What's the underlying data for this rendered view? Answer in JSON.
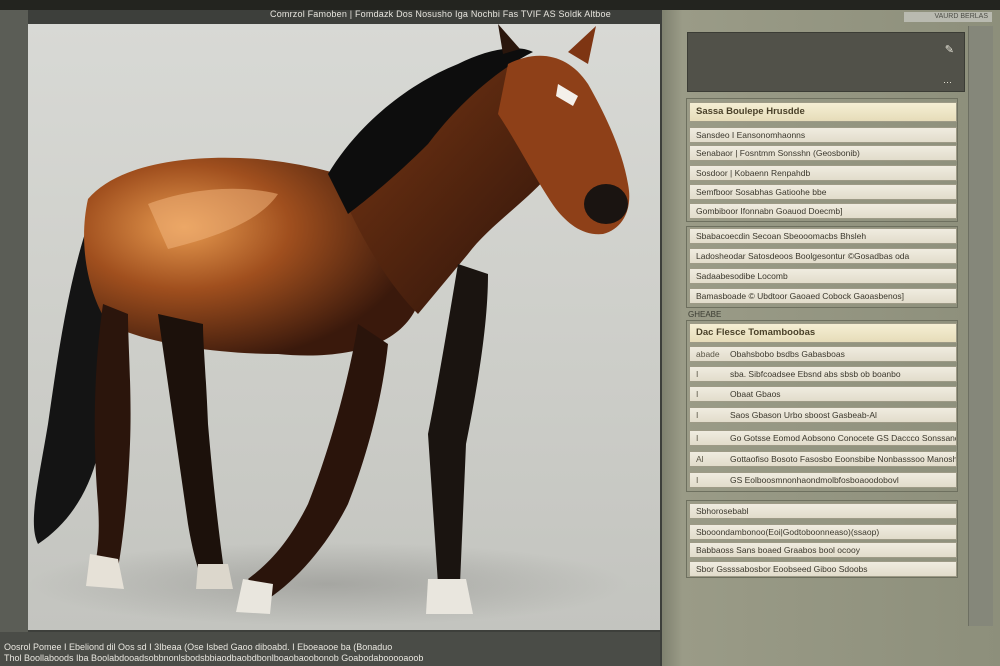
{
  "window": {
    "title": "Comrzol Famoben | Fomdazk Dos Nosusho Iga Nochbi Fas TVIF AS Soldk Altboe",
    "tab_label": "VAURD BERLAS"
  },
  "preview_icons": [
    "pencil-icon",
    "dots-icon"
  ],
  "panel": {
    "group1": {
      "header": "Sassa Boulepe Hrusdde",
      "rows": [
        "Sansdeo I Eansonomhaonns",
        "Senabaor | Fosntmm Sonsshn (Geosbonib)",
        "Sosdoor | Kobaenn Renpahdb",
        "Semfboor Sosabhas Gatioohe bbe",
        "Gombiboor Ifonnabn Goauod Doecmb]"
      ]
    },
    "group2": {
      "rows": [
        "Sbabacoecdin Secoan Sbeooomacbs Bhsleh",
        "Ladosheodar Satosdeoos Boolgesontur ©Gosadbas oda",
        "Sadaabesodibe Locomb",
        "Bamasboade © Ubdtoor Gaoaed Cobock Gaoasbenos]"
      ],
      "label": "GHEABE"
    },
    "group3": {
      "header": "Dac Flesce Tomamboobas",
      "rows": [
        {
          "num": "abade",
          "text": "Obahsbobo bsdbs Gabasboas"
        },
        {
          "num": "I",
          "text": "sba. Sibfcoadsee Ebsnd abs sbsb ob boanbo"
        },
        {
          "num": "I",
          "text": "Obaat Gbaos"
        },
        {
          "num": "I",
          "text": "Saos Gbason Urbo sboost Gasbeab-Al"
        },
        {
          "num": "I",
          "text": "Go Gotsse Eomod Aobsono Conocete GS Daccco Sonssand"
        },
        {
          "num": "Al",
          "text": "Gottaofiso Bosoto Fasosbo Eoonsbibe Nonbasssoo Manosho"
        },
        {
          "num": "I",
          "text": "GS Eolboosmnonhaondmolbfosboaoodobovl"
        }
      ]
    },
    "group4": {
      "label": "Sbhorosebabl",
      "rows": [
        "Sbooondambonoo(Eoi|Godtoboonneaso)(ssaop)",
        "Babbaoss Sans boaed Graabos bool ocooy",
        "Sbor Gssssabosbor Eoobseed Giboo Sdoobs"
      ]
    }
  },
  "status": {
    "line1": "Oosrol Pomee I Ebeliond dil Oos sd I 3Ibeaa (Ose Isbed Gaoo diboabd. I Eboeaooe ba (Bonaduo",
    "line2": "Thol Boollaboods Iba Boolabdooadsobbnonlsbodsbbiaodbaobdbonlboaobaoobonob Goabodabooooaoob"
  },
  "colors": {
    "panel_bg": "#8d8f7b",
    "row_bg": "#e2dccb",
    "horse_body": "#a04f1e"
  }
}
